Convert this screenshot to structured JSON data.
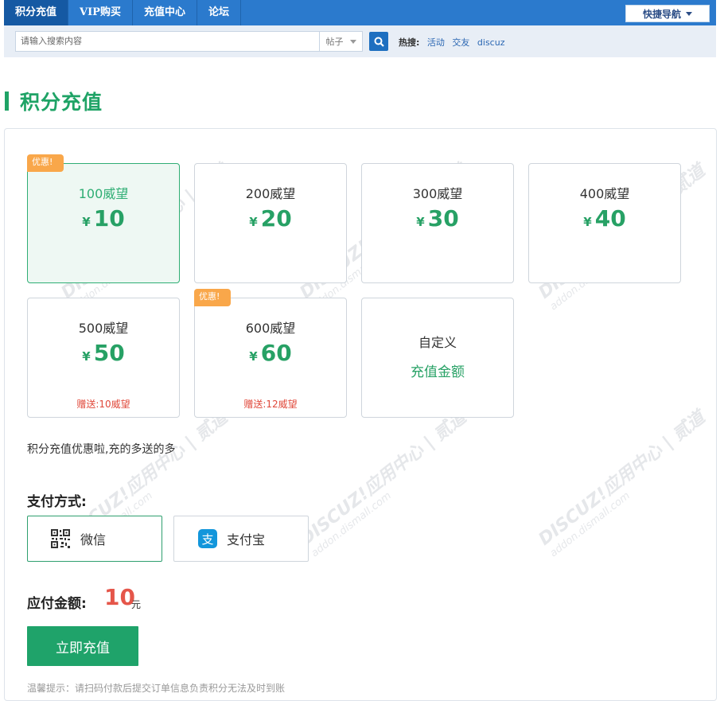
{
  "nav": {
    "tabs": [
      {
        "label": "积分充值",
        "active": true
      },
      {
        "label": "VIP购买",
        "active": false
      },
      {
        "label": "充值中心",
        "active": false
      },
      {
        "label": "论坛",
        "active": false
      }
    ],
    "quick_nav_label": "快捷导航"
  },
  "search": {
    "placeholder": "请输入搜索内容",
    "type_value": "帖子",
    "hot_label": "热搜:",
    "hot_keywords": [
      "活动",
      "交友",
      "discuz"
    ]
  },
  "page_title": "积分充值",
  "packages": [
    {
      "label": "100威望",
      "currency": "¥",
      "price": "10",
      "promo": "优惠!",
      "bonus": "",
      "selected": true
    },
    {
      "label": "200威望",
      "currency": "¥",
      "price": "20",
      "promo": "",
      "bonus": "",
      "selected": false
    },
    {
      "label": "300威望",
      "currency": "¥",
      "price": "30",
      "promo": "",
      "bonus": "",
      "selected": false
    },
    {
      "label": "400威望",
      "currency": "¥",
      "price": "40",
      "promo": "",
      "bonus": "",
      "selected": false
    },
    {
      "label": "500威望",
      "currency": "¥",
      "price": "50",
      "promo": "",
      "bonus": "赠送:10威望",
      "selected": false
    },
    {
      "label": "600威望",
      "currency": "¥",
      "price": "60",
      "promo": "优惠!",
      "bonus": "赠送:12威望",
      "selected": false
    }
  ],
  "custom_package": {
    "line1": "自定义",
    "line2": "充值金额"
  },
  "note": "积分充值优惠啦,充的多送的多",
  "payment": {
    "label": "支付方式:",
    "options": [
      {
        "label": "微信",
        "icon": "qrcode-icon",
        "selected": true
      },
      {
        "label": "支付宝",
        "icon": "alipay-icon",
        "selected": false
      }
    ]
  },
  "due": {
    "label": "应付金额:",
    "amount": "10",
    "unit": "元"
  },
  "submit_label": "立即充值",
  "tip": "温馨提示：请扫码付款后提交订单信息负责积分无法及时到账",
  "watermark": {
    "line1": "DISCUZ!应用中心 | 贰道",
    "line2": "addon.dismall.com"
  },
  "colors": {
    "brand_green": "#1fa366",
    "nav_blue": "#2b7acd",
    "price_red": "#e5564a",
    "promo_orange": "#f9a74a"
  }
}
